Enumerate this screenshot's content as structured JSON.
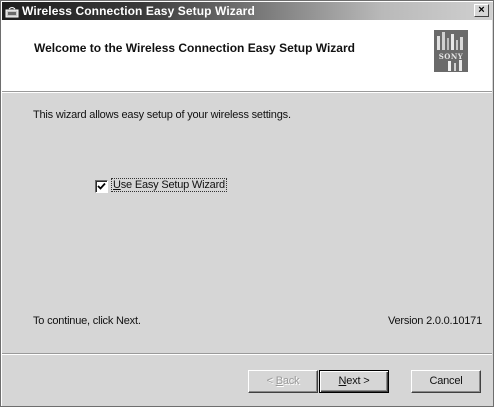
{
  "window": {
    "title": "Wireless Connection Easy Setup Wizard",
    "close_glyph": "×",
    "app_icon": "wireless-app-icon"
  },
  "header": {
    "title": "Welcome to the Wireless Connection Easy Setup Wizard",
    "logo_text": "SONY",
    "logo_icon": "sony-logo"
  },
  "body": {
    "intro": "This wizard allows easy setup of your wireless settings.",
    "checkbox": {
      "mnemonic": "U",
      "label_rest": "se Easy Setup Wizard",
      "checked": true
    },
    "continue_text": "To continue, click Next.",
    "version": "Version 2.0.0.10171"
  },
  "buttons": {
    "back": {
      "prefix": "< ",
      "mnemonic": "B",
      "rest": "ack",
      "enabled": false
    },
    "next": {
      "mnemonic": "N",
      "rest": "ext >",
      "enabled": true,
      "default": true
    },
    "cancel": {
      "label": "Cancel",
      "enabled": true
    }
  },
  "colors": {
    "title_gradient_start": "#1e1e1e",
    "title_gradient_end": "#d0d0d0",
    "dialog_face": "#d6d6d6",
    "header_bg": "#ffffff"
  }
}
